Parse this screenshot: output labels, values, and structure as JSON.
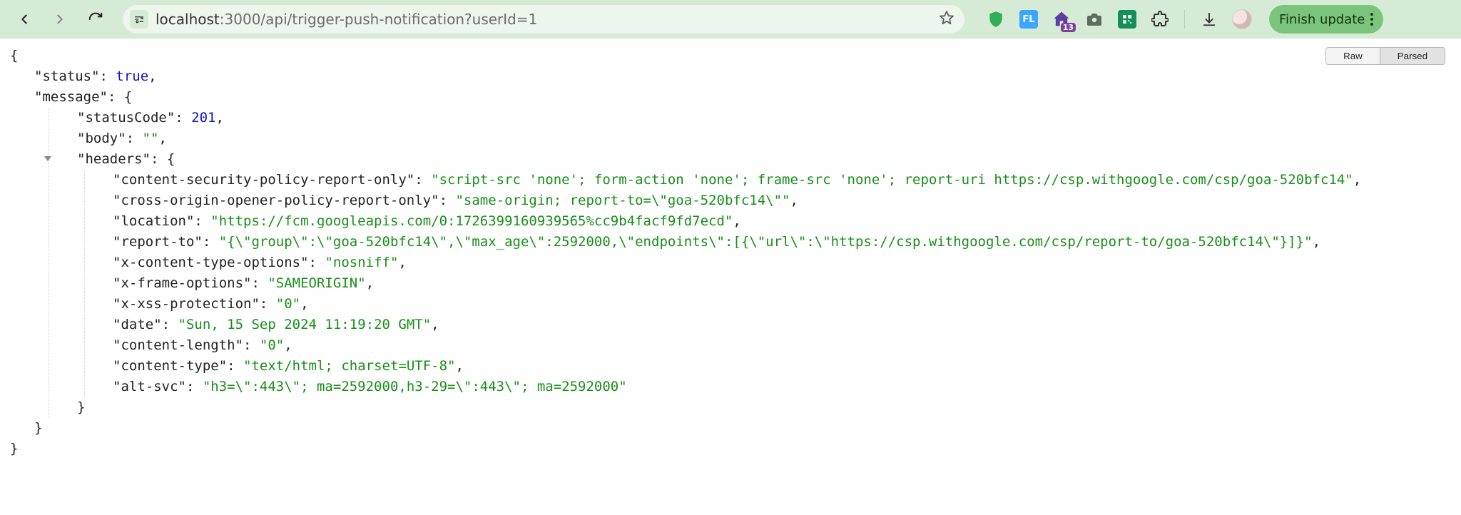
{
  "toolbar": {
    "url_host": "localhost",
    "url_port": ":3000",
    "url_path": "/api/trigger-push-notification?userId=1",
    "update_label": "Finish update",
    "ext_fl_label": "FL",
    "ext_home_badge": "13"
  },
  "toggle": {
    "raw": "Raw",
    "parsed": "Parsed"
  },
  "json": {
    "status_key": "\"status\"",
    "status_val": "true",
    "message_key": "\"message\"",
    "statusCode_key": "\"statusCode\"",
    "statusCode_val": "201",
    "body_key": "\"body\"",
    "body_val": "\"\"",
    "headers_key": "\"headers\"",
    "h": {
      "csp_k": "\"content-security-policy-report-only\"",
      "csp_v": "\"script-src 'none'; form-action 'none'; frame-src 'none'; report-uri https://csp.withgoogle.com/csp/goa-520bfc14\"",
      "coop_k": "\"cross-origin-opener-policy-report-only\"",
      "coop_v": "\"same-origin; report-to=\\\"goa-520bfc14\\\"\"",
      "loc_k": "\"location\"",
      "loc_v": "\"https://fcm.googleapis.com/0:1726399160939565%cc9b4facf9fd7ecd\"",
      "rep_k": "\"report-to\"",
      "rep_v": "\"{\\\"group\\\":\\\"goa-520bfc14\\\",\\\"max_age\\\":2592000,\\\"endpoints\\\":[{\\\"url\\\":\\\"https://csp.withgoogle.com/csp/report-to/goa-520bfc14\\\"}]}\"",
      "xcto_k": "\"x-content-type-options\"",
      "xcto_v": "\"nosniff\"",
      "xfo_k": "\"x-frame-options\"",
      "xfo_v": "\"SAMEORIGIN\"",
      "xxp_k": "\"x-xss-protection\"",
      "xxp_v": "\"0\"",
      "date_k": "\"date\"",
      "date_v": "\"Sun, 15 Sep 2024 11:19:20 GMT\"",
      "clen_k": "\"content-length\"",
      "clen_v": "\"0\"",
      "ctype_k": "\"content-type\"",
      "ctype_v": "\"text/html; charset=UTF-8\"",
      "alt_k": "\"alt-svc\"",
      "alt_v": "\"h3=\\\":443\\\"; ma=2592000,h3-29=\\\":443\\\"; ma=2592000\""
    }
  }
}
